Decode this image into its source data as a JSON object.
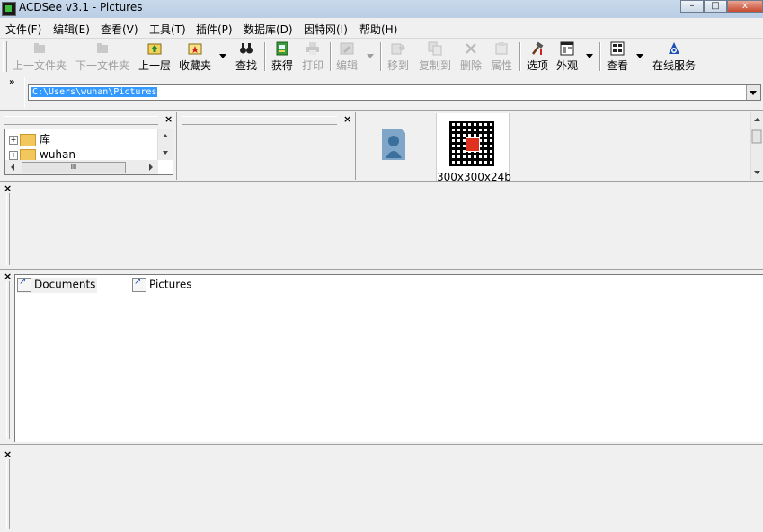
{
  "window": {
    "title": "ACDSee v3.1 - Pictures",
    "controls": {
      "minimize": "–",
      "maximize": "□",
      "close": "x"
    }
  },
  "menu": {
    "items": [
      "文件(F)",
      "编辑(E)",
      "查看(V)",
      "工具(T)",
      "插件(P)",
      "数据库(D)",
      "因特网(I)",
      "帮助(H)"
    ]
  },
  "toolbar": {
    "buttons": [
      {
        "label": "上一文件夹",
        "icon": "folder-up-icon",
        "enabled": false
      },
      {
        "label": "下一文件夹",
        "icon": "folder-next-icon",
        "enabled": false
      },
      {
        "label": "上一层",
        "icon": "up-level-icon",
        "enabled": true
      },
      {
        "label": "收藏夹",
        "icon": "favorites-icon",
        "enabled": true
      },
      {
        "label": "查找",
        "icon": "binoculars-icon",
        "enabled": true
      },
      {
        "label": "获得",
        "icon": "acquire-icon",
        "enabled": true
      },
      {
        "label": "打印",
        "icon": "print-icon",
        "enabled": false
      },
      {
        "label": "编辑",
        "icon": "edit-icon",
        "enabled": false
      },
      {
        "label": "移到",
        "icon": "move-icon",
        "enabled": false
      },
      {
        "label": "复制到",
        "icon": "copy-icon",
        "enabled": false
      },
      {
        "label": "删除",
        "icon": "delete-icon",
        "enabled": false
      },
      {
        "label": "属性",
        "icon": "properties-icon",
        "enabled": false
      },
      {
        "label": "选项",
        "icon": "options-icon",
        "enabled": true
      },
      {
        "label": "外观",
        "icon": "appearance-icon",
        "enabled": true
      },
      {
        "label": "查看",
        "icon": "view-icon",
        "enabled": true
      },
      {
        "label": "在线服务",
        "icon": "online-service-icon",
        "enabled": true
      }
    ]
  },
  "address": {
    "chevron": "»",
    "value": "C:\\Users\\wuhan\\Pictures"
  },
  "folder_tree": {
    "items": [
      {
        "label": "库",
        "expander": "+"
      },
      {
        "label": "wuhan",
        "expander": "+"
      }
    ],
    "hscroll_thumb": "III"
  },
  "preview": {
    "thumbnail_label": "300x300x24b"
  },
  "file_list": {
    "items": [
      "Documents",
      "Pictures"
    ]
  },
  "pane_close": "×"
}
